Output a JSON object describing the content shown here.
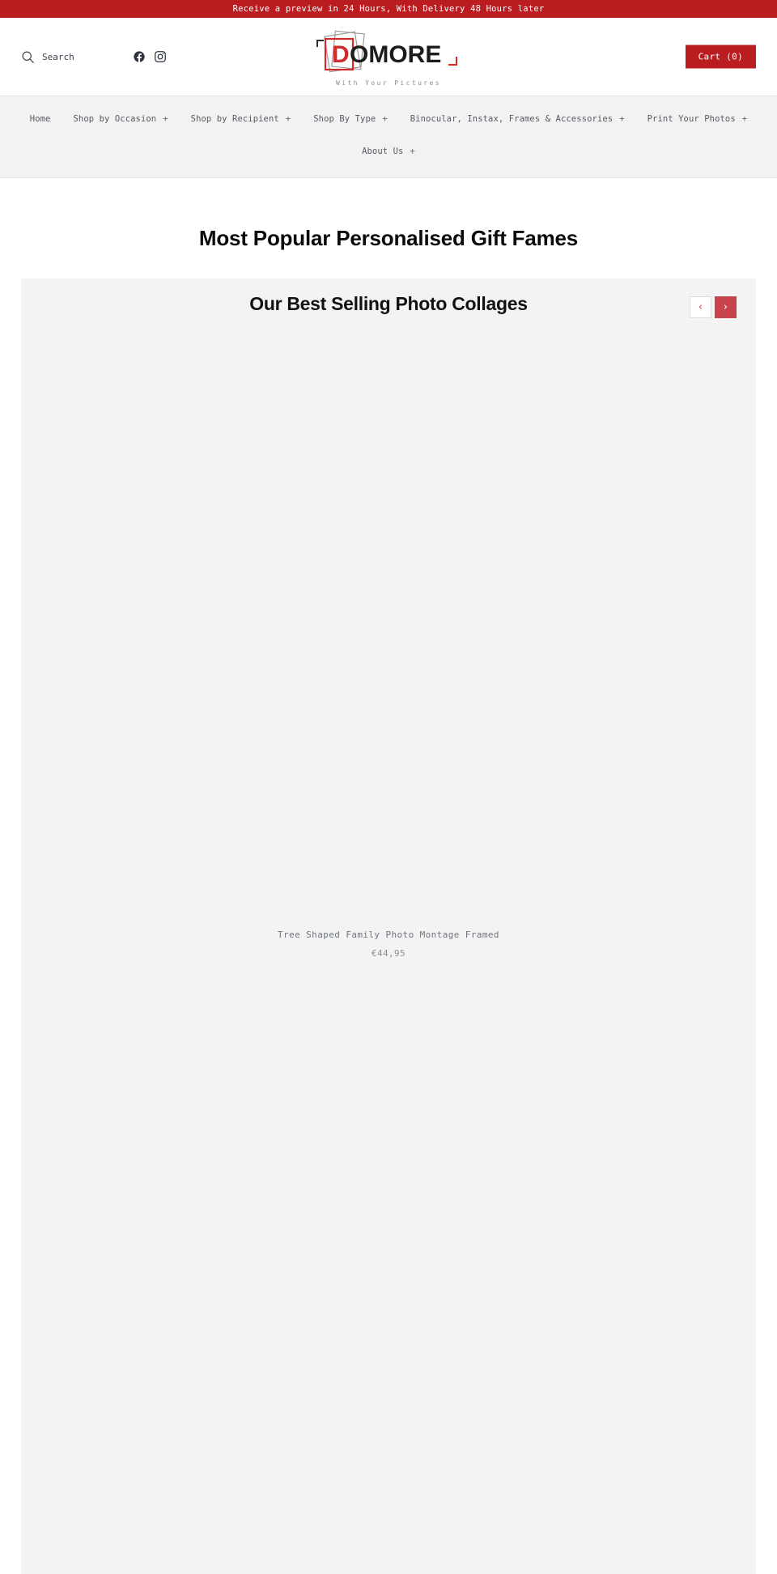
{
  "announcement": {
    "text": "Receive a preview in 24 Hours, With Delivery 48 Hours later",
    "bg_color": "#bb1c20",
    "text_color": "#ffffff"
  },
  "header": {
    "search": {
      "label": "Search",
      "icon": "search-icon"
    },
    "social": [
      {
        "name": "facebook-icon",
        "label": "Facebook"
      },
      {
        "name": "instagram-icon",
        "label": "Instagram"
      }
    ],
    "logo": {
      "text": "DOMORE",
      "tagline": "With Your Pictures",
      "accent_color": "#d12b2b"
    },
    "cart": {
      "label": "Cart (0)",
      "count": 0,
      "bg_color": "#bb1c20"
    }
  },
  "nav": {
    "row1": [
      {
        "label": "Home",
        "has_submenu": false
      },
      {
        "label": "Shop by Occasion",
        "has_submenu": true
      },
      {
        "label": "Shop by Recipient",
        "has_submenu": true
      },
      {
        "label": "Shop By Type",
        "has_submenu": true
      },
      {
        "label": "Binocular, Instax, Frames & Accessories",
        "has_submenu": true
      },
      {
        "label": "Print Your Photos",
        "has_submenu": true
      }
    ],
    "row2": [
      {
        "label": "About Us",
        "has_submenu": true
      }
    ],
    "plus_symbol": "+"
  },
  "page": {
    "heading": "Most Popular Personalised Gift Fames"
  },
  "carousel": {
    "title": "Our Best Selling Photo Collages",
    "prev_label": "‹",
    "next_label": "›",
    "prev_color": "#c8434b",
    "next_bg_color": "#c8434b",
    "slides": [
      {
        "title": "Tree Shaped Family Photo Montage Framed",
        "price": "€44,95"
      },
      {
        "title": "",
        "price": ""
      }
    ]
  }
}
